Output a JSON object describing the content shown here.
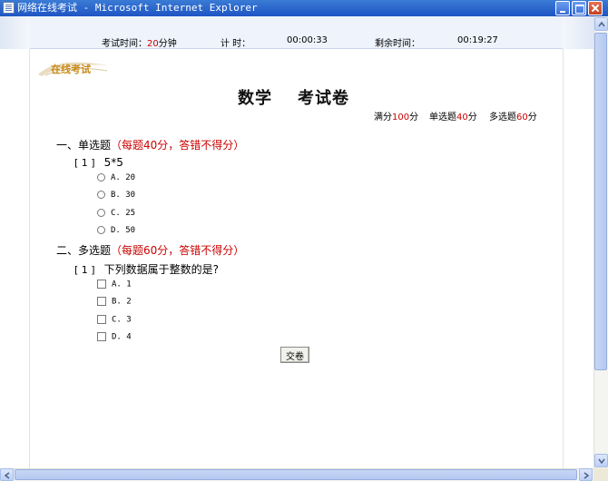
{
  "window": {
    "title": "网络在线考试 - Microsoft Internet Explorer"
  },
  "timer": {
    "exam_time_label": "考试时间：",
    "exam_time_value": "20",
    "exam_time_unit": "分钟",
    "elapsed_label": "计 时：",
    "elapsed_value": "00:00:33",
    "remaining_label": "剩余时间：",
    "remaining_value": "00:19:27"
  },
  "logo": {
    "text": "在线考试"
  },
  "exam": {
    "subject": "数学",
    "title": "考试卷",
    "summary": {
      "full_label": "满分",
      "full_value": "100",
      "full_unit": "分",
      "single_label": "单选题",
      "single_value": "40",
      "single_unit": "分",
      "multi_label": "多选题",
      "multi_value": "60",
      "multi_unit": "分"
    }
  },
  "sections": [
    {
      "heading": "一、单选题",
      "note": "（每题40分，答错不得分）",
      "questions": [
        {
          "number": "[ 1 ]",
          "text": "5*5",
          "options": [
            "A. 20",
            "B. 30",
            "C. 25",
            "D. 50"
          ]
        }
      ]
    },
    {
      "heading": "二、多选题",
      "note": "（每题60分，答错不得分）",
      "questions": [
        {
          "number": "[ 1 ]",
          "text": "下列数据属于整数的是?",
          "options": [
            "A. 1",
            "B. 2",
            "C. 3",
            "D. 4"
          ]
        }
      ]
    }
  ],
  "submit_label": "交卷",
  "colors": {
    "accent_red": "#cc0000",
    "title_bar": "#1f55c4",
    "logo_gold": "#c98a17"
  }
}
